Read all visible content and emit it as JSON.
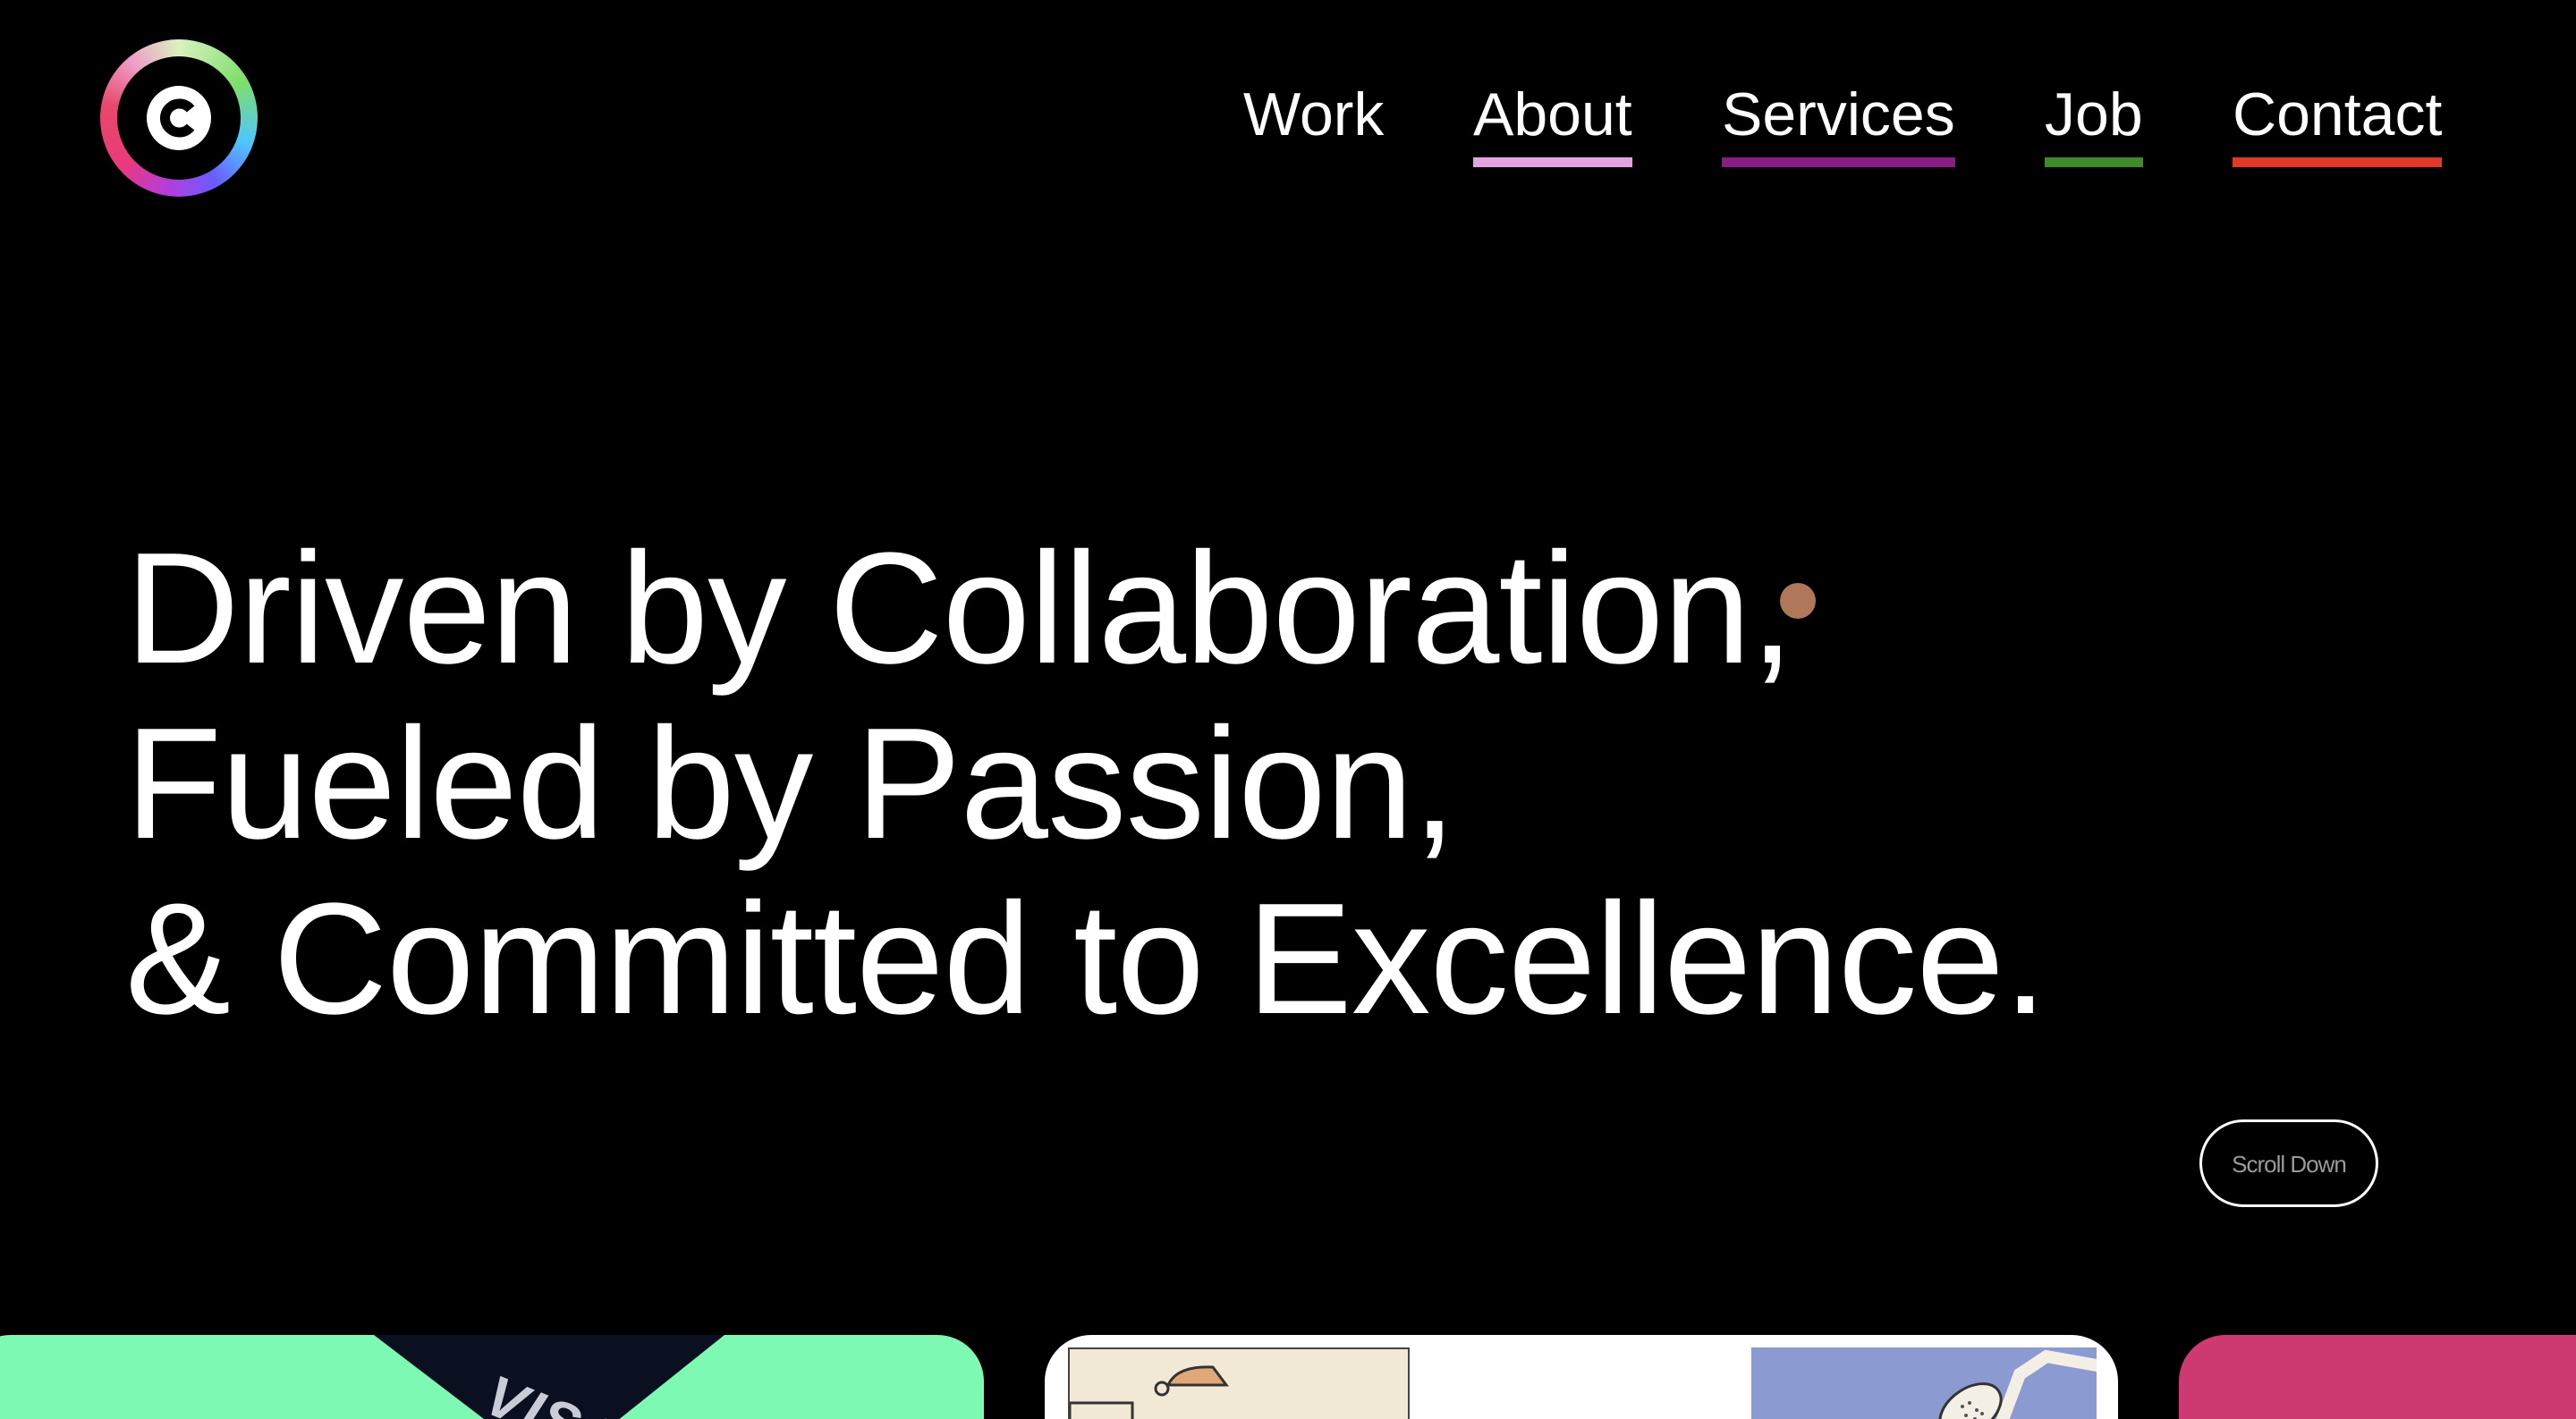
{
  "brand": {
    "logo_letter": "C"
  },
  "nav": {
    "items": [
      {
        "label": "Work",
        "underline_color": ""
      },
      {
        "label": "About",
        "underline_color": "#e3a3e0"
      },
      {
        "label": "Services",
        "underline_color": "#8a1a84"
      },
      {
        "label": "Job",
        "underline_color": "#3f8a2a"
      },
      {
        "label": "Contact",
        "underline_color": "#e0392a"
      }
    ]
  },
  "hero": {
    "line1": "Driven by Collaboration,",
    "line2": "Fueled by Passion,",
    "line3": "& Committed to Excellence."
  },
  "scroll": {
    "label": "Scroll Down"
  },
  "cards": {
    "visa_text": "VISA"
  },
  "colors": {
    "background": "#000000",
    "text": "#ffffff",
    "cursor_dot": "#b0785a",
    "card_green": "#7df9b4",
    "card_white": "#ffffff",
    "card_pink": "#cd3a71"
  }
}
